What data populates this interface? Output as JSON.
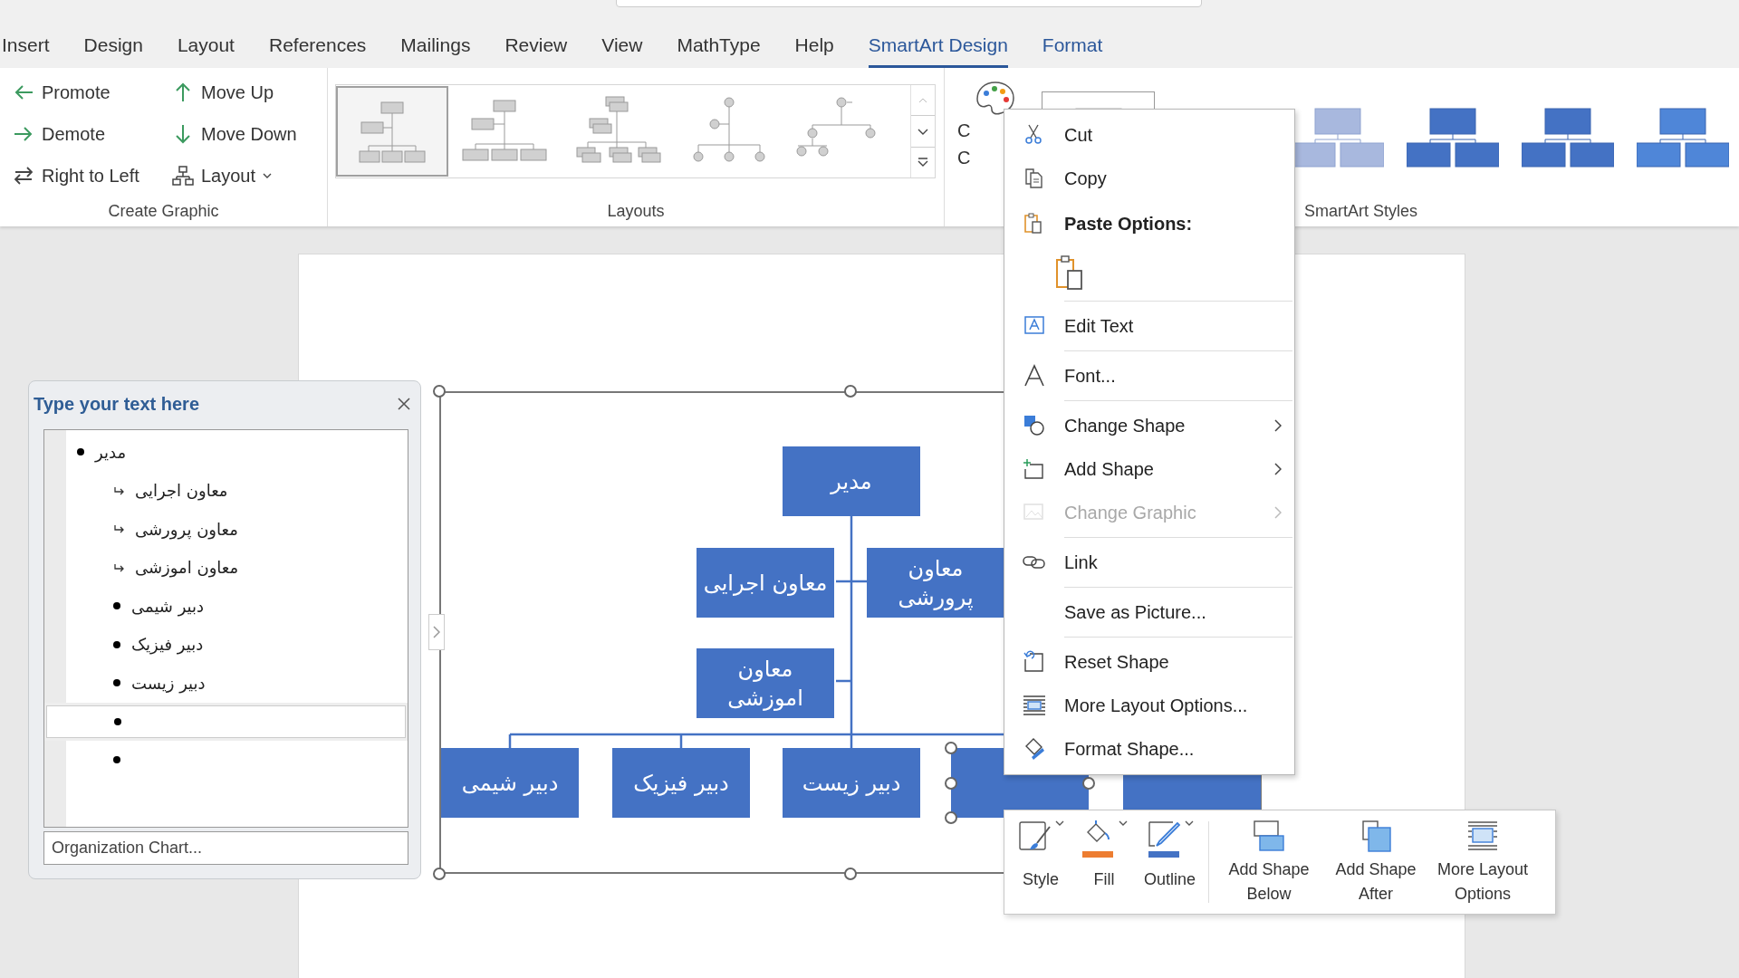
{
  "tabs": [
    {
      "label": "Insert",
      "selected": false,
      "contextual": false
    },
    {
      "label": "Design",
      "selected": false,
      "contextual": false
    },
    {
      "label": "Layout",
      "selected": false,
      "contextual": false
    },
    {
      "label": "References",
      "selected": false,
      "contextual": false
    },
    {
      "label": "Mailings",
      "selected": false,
      "contextual": false
    },
    {
      "label": "Review",
      "selected": false,
      "contextual": false
    },
    {
      "label": "View",
      "selected": false,
      "contextual": false
    },
    {
      "label": "MathType",
      "selected": false,
      "contextual": false
    },
    {
      "label": "Help",
      "selected": false,
      "contextual": false
    },
    {
      "label": "SmartArt Design",
      "selected": true,
      "contextual": true
    },
    {
      "label": "Format",
      "selected": false,
      "contextual": true
    }
  ],
  "ribbon": {
    "create_graphic": {
      "label": "Create Graphic",
      "columns": [
        [
          {
            "label": "Promote",
            "dropdown": false
          },
          {
            "label": "Demote",
            "dropdown": false
          },
          {
            "label": "Right to Left",
            "dropdown": false
          }
        ],
        [
          {
            "label": "Move Up",
            "dropdown": false
          },
          {
            "label": "Move Down",
            "dropdown": false
          },
          {
            "label": "Layout",
            "dropdown": true
          }
        ]
      ]
    },
    "layouts": {
      "label": "Layouts",
      "items": [
        {
          "selected": true
        },
        {
          "selected": false
        },
        {
          "selected": false
        },
        {
          "selected": false
        },
        {
          "selected": false
        }
      ]
    },
    "change_colors": {
      "label_lines": [
        "C",
        "C"
      ]
    },
    "smartart_styles": {
      "label": "SmartArt Styles",
      "items": [
        {
          "selected": true
        },
        {
          "selected": false
        },
        {
          "selected": false
        },
        {
          "selected": false
        },
        {
          "selected": false
        }
      ]
    }
  },
  "text_pane": {
    "title": "Type your text here",
    "items": [
      {
        "text": "مدیر",
        "kind": "bullet",
        "selected": false,
        "children": [
          {
            "text": "معاون اجرایی",
            "kind": "assistant",
            "selected": false
          },
          {
            "text": "معاون پرورشی",
            "kind": "assistant",
            "selected": false
          },
          {
            "text": "معاون اموزشی",
            "kind": "assistant",
            "selected": false
          },
          {
            "text": "دبیر شیمی",
            "kind": "bullet",
            "selected": false
          },
          {
            "text": "دبیر فیزیک",
            "kind": "bullet",
            "selected": false
          },
          {
            "text": "دبیر زیست",
            "kind": "bullet",
            "selected": false
          },
          {
            "kind": "bullet",
            "selected": true
          },
          {
            "kind": "bullet",
            "selected": false
          }
        ]
      }
    ],
    "footer_link": "Organization Chart..."
  },
  "diagram": {
    "nodes": [
      {
        "text": "مدیر",
        "kind": "root",
        "selected": false
      },
      {
        "text": "معاون پرورشی",
        "kind": "assistant",
        "selected": false
      },
      {
        "text": "معاون اجرایی",
        "kind": "assistant",
        "selected": false
      },
      {
        "text": "معاون اموزشی",
        "kind": "assistant",
        "selected": false
      },
      {
        "kind": "child",
        "selected": false
      },
      {
        "kind": "child",
        "selected": true
      },
      {
        "text": "دبیر زیست",
        "kind": "child",
        "selected": false
      },
      {
        "text": "دبیر فیزیک",
        "kind": "child",
        "selected": false
      },
      {
        "text": "دبیر شیمی",
        "kind": "child",
        "selected": false
      }
    ]
  },
  "context_menu": {
    "items": [
      {
        "kind": "item",
        "label": "Cut",
        "disabled": false,
        "submenu": false,
        "separator": false
      },
      {
        "kind": "item",
        "label": "Copy",
        "disabled": false,
        "submenu": false,
        "separator": false
      },
      {
        "kind": "header",
        "label": "Paste Options:",
        "disabled": false,
        "submenu": false,
        "separator": false
      },
      {
        "kind": "paste_option",
        "disabled": false,
        "submenu": false,
        "separator": false
      },
      {
        "kind": "item",
        "label": "Edit Text",
        "disabled": false,
        "submenu": false,
        "separator": true
      },
      {
        "kind": "item",
        "label": "Font...",
        "disabled": false,
        "submenu": false,
        "separator": true
      },
      {
        "kind": "item",
        "label": "Change Shape",
        "disabled": false,
        "submenu": true,
        "separator": true
      },
      {
        "kind": "item",
        "label": "Add Shape",
        "disabled": false,
        "submenu": true,
        "separator": false
      },
      {
        "kind": "item",
        "label": "Change Graphic",
        "disabled": true,
        "submenu": true,
        "separator": false
      },
      {
        "kind": "item",
        "label": "Link",
        "disabled": false,
        "submenu": false,
        "separator": true
      },
      {
        "kind": "item",
        "label": "Save as Picture...",
        "disabled": false,
        "submenu": false,
        "separator": true
      },
      {
        "kind": "item",
        "label": "Reset Shape",
        "disabled": false,
        "submenu": false,
        "separator": true
      },
      {
        "kind": "item",
        "label": "More Layout Options...",
        "disabled": false,
        "submenu": false,
        "separator": false
      },
      {
        "kind": "item",
        "label": "Format Shape...",
        "disabled": false,
        "submenu": false,
        "separator": false
      }
    ]
  },
  "mini_toolbar": {
    "format_buttons": [
      {
        "label": "Style"
      },
      {
        "label": "Fill",
        "color": "#ed7d31"
      },
      {
        "label": "Outline",
        "color": "#4472c4"
      }
    ],
    "shape_buttons": [
      {
        "label": "Add Shape Below"
      },
      {
        "label": "Add Shape After"
      },
      {
        "label": "More Layout Options"
      }
    ]
  }
}
